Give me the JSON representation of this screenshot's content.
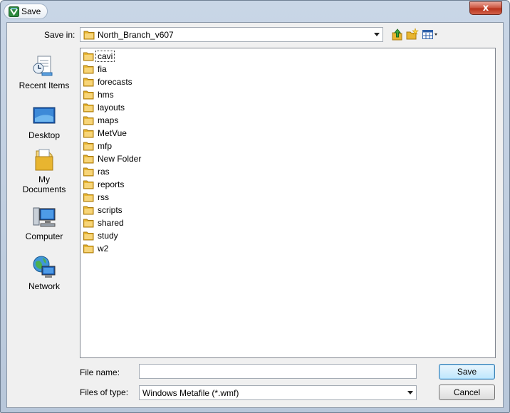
{
  "window": {
    "title": "Save",
    "close_glyph": "x"
  },
  "toolbar": {
    "save_in_label": "Save in:",
    "save_in_value": "North_Branch_v607",
    "buttons": [
      "up-one-level-icon",
      "create-new-folder-icon",
      "view-menu-icon"
    ]
  },
  "places": [
    {
      "label": "Recent Items",
      "icon": "recent-items-icon"
    },
    {
      "label": "Desktop",
      "icon": "desktop-icon"
    },
    {
      "label": "My\nDocuments",
      "label_line1": "My",
      "label_line2": "Documents",
      "icon": "my-documents-icon"
    },
    {
      "label": "Computer",
      "icon": "computer-icon"
    },
    {
      "label": "Network",
      "icon": "network-icon"
    }
  ],
  "files": [
    "cavi",
    "fia",
    "forecasts",
    "hms",
    "layouts",
    "maps",
    "MetVue",
    "mfp",
    "New Folder",
    "ras",
    "reports",
    "rss",
    "scripts",
    "shared",
    "study",
    "w2"
  ],
  "footer": {
    "file_name_label": "File name:",
    "file_name_value": "",
    "file_type_label": "Files of type:",
    "file_type_value": "Windows Metafile (*.wmf)",
    "save_label": "Save",
    "cancel_label": "Cancel"
  },
  "colors": {
    "folder": "#e8b530",
    "accent": "#3c7fb1"
  }
}
